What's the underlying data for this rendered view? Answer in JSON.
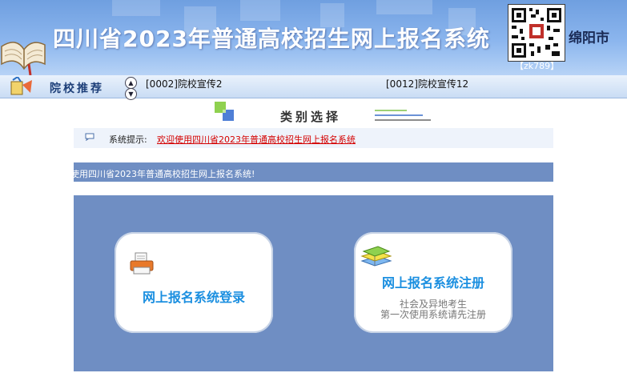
{
  "header": {
    "title": "四川省2023年普通高校招生网上报名系统",
    "qr_code_label": "【zk789】",
    "city": "绵阳市"
  },
  "recommend_bar": {
    "label": "院校推荐",
    "items": [
      "[0002]院校宣传2",
      "[0012]院校宣传12"
    ]
  },
  "category": {
    "title": "类别选择"
  },
  "tip": {
    "label": "系统提示:",
    "message": "欢迎使用四川省2023年普通高校招生网上报名系统"
  },
  "marquee": {
    "text": "使用四川省2023年普通高校招生网上报名系统!"
  },
  "cards": {
    "login": {
      "title": "网上报名系统登录"
    },
    "register": {
      "title": "网上报名系统注册",
      "sub1": "社会及异地考生",
      "sub2": "第一次使用系统请先注册"
    }
  },
  "colors": {
    "header_blue": "#7eaae8",
    "main_panel": "#6f8ec3",
    "card_title": "#1b8fe0",
    "tip_text": "#d40000"
  },
  "icons": [
    "book-icon",
    "qr-code",
    "recommend-icon",
    "arrow-up-icon",
    "arrow-down-icon",
    "category-icon",
    "speech-bubble-icon",
    "printer-icon",
    "books-icon"
  ]
}
